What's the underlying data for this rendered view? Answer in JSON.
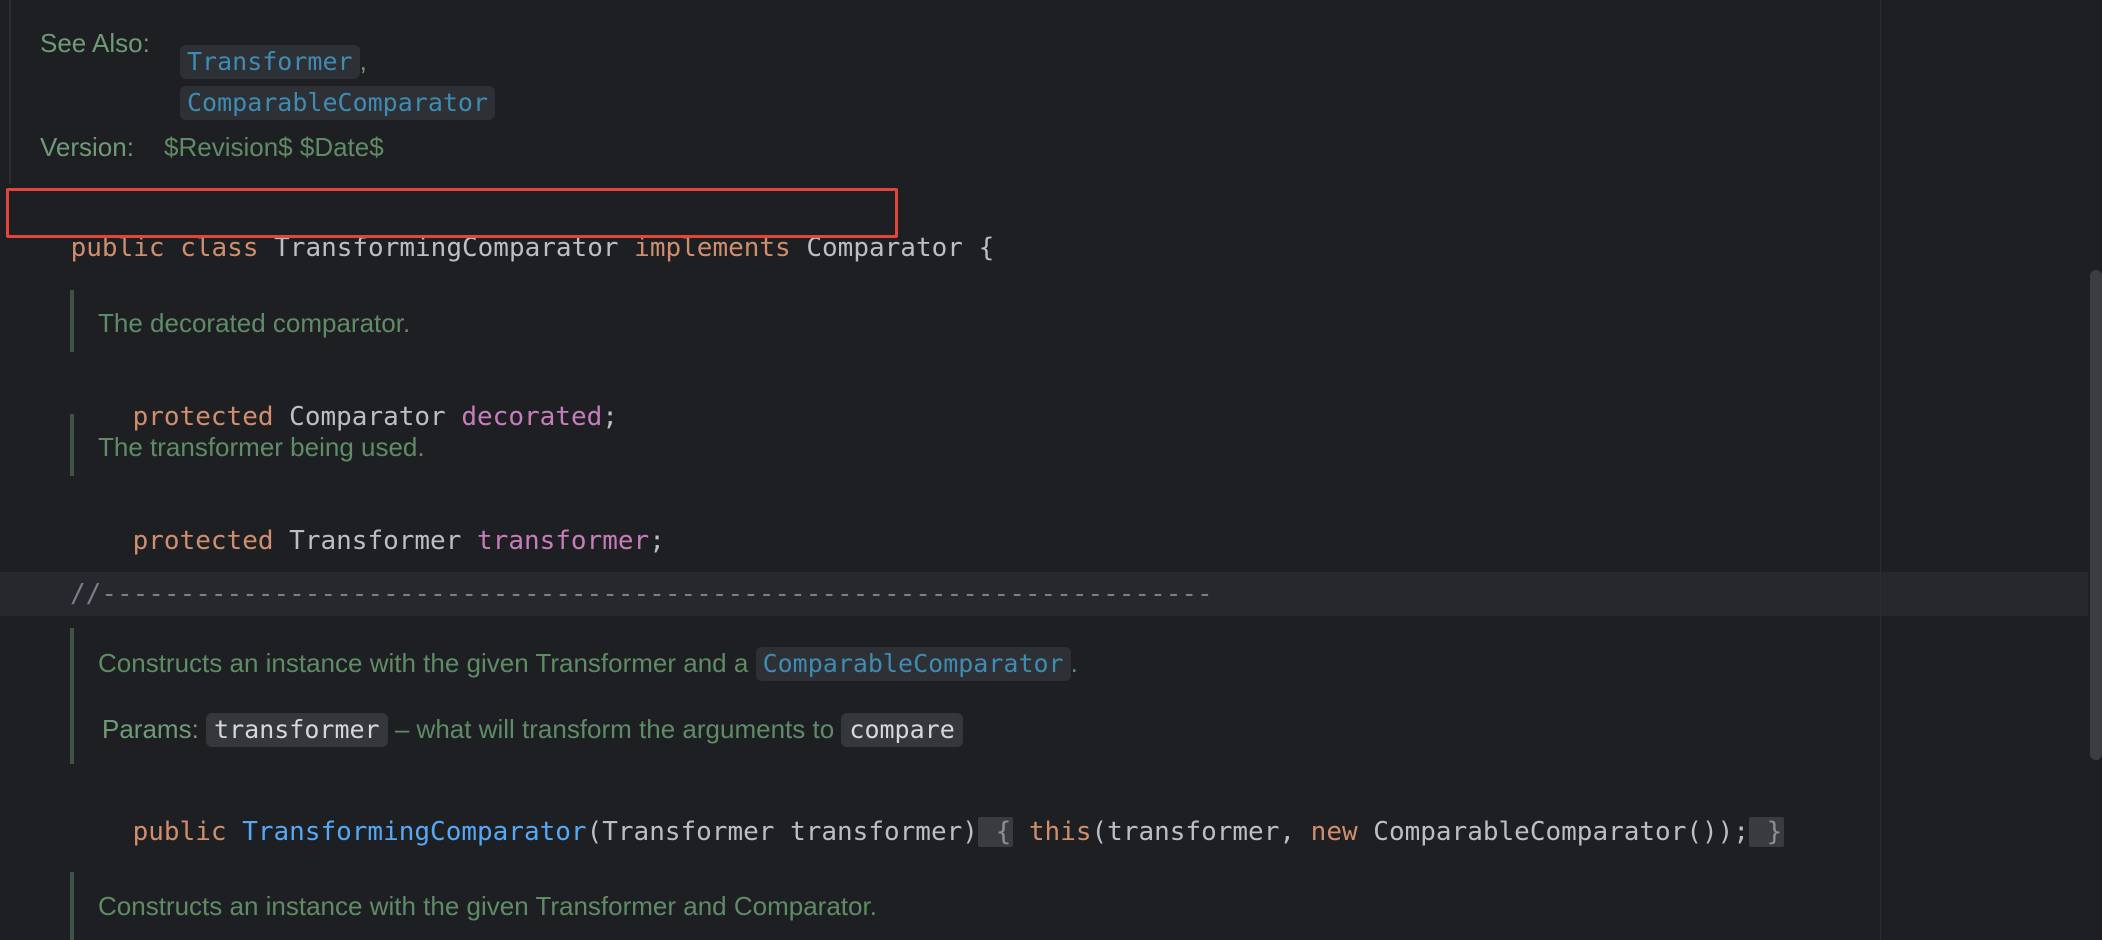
{
  "javadoc_class": {
    "see_also_label": "See Also:",
    "see_also_links": [
      "Transformer",
      "ComparableComparator"
    ],
    "see_also_separator": ",",
    "version_label": "Version:",
    "version_value": "$Revision$ $Date$"
  },
  "class_declaration": {
    "kw_public": "public",
    "kw_class": "class",
    "class_name": "TransformingComparator",
    "kw_implements": "implements",
    "interface_name": "Comparator",
    "open_brace": "{"
  },
  "field_decorated": {
    "doc": "The decorated comparator.",
    "modifier": "protected",
    "type": "Comparator",
    "name": "decorated",
    "semicolon": ";"
  },
  "field_transformer": {
    "doc": "The transformer being used.",
    "modifier": "protected",
    "type": "Transformer",
    "name": "transformer",
    "semicolon": ";"
  },
  "separator_comment": "//-----------------------------------------------------------------------",
  "constructor_one": {
    "doc_prefix": "Constructs an instance with the given Transformer and a",
    "doc_link": "ComparableComparator",
    "doc_suffix": ".",
    "params_label": "Params:",
    "param_name": "transformer",
    "param_desc": "– what will transform the arguments to",
    "param_ref": "compare",
    "kw_public": "public",
    "name": "TransformingComparator",
    "signature_rest": "(Transformer transformer)",
    "fold_open": " {",
    "kw_this": "this",
    "call_args_start": "(transformer, ",
    "kw_new": "new",
    "call_args_end": " ComparableComparator());",
    "fold_close": " }"
  },
  "constructor_two": {
    "doc": "Constructs an instance with the given Transformer and Comparator."
  },
  "colors": {
    "background": "#1e1f22",
    "keyword": "#cf8e6d",
    "field": "#c77dbb",
    "function": "#56a8f5",
    "doc_text": "#5f8c66",
    "link": "#3f8bb2",
    "selection_border": "#e0463c"
  }
}
